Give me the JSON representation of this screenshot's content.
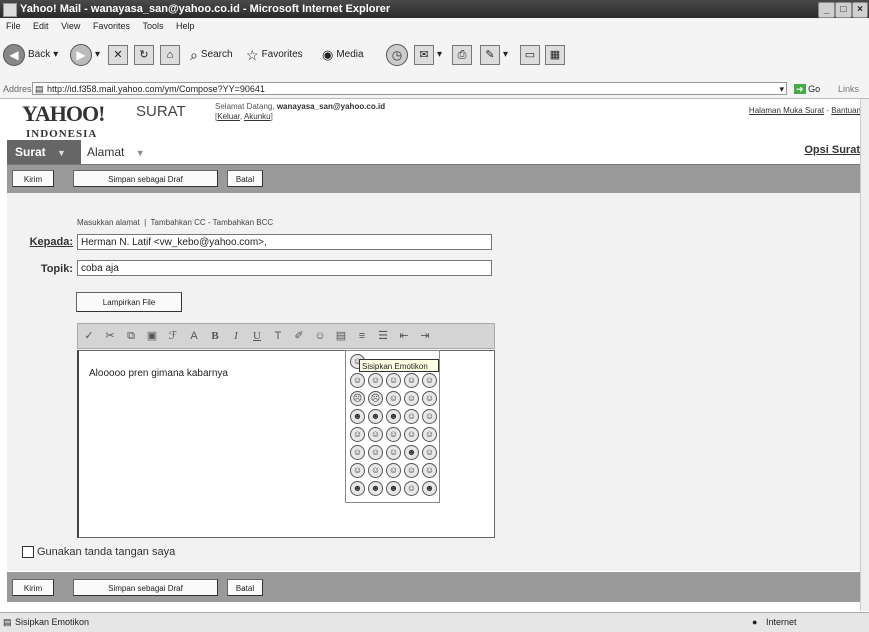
{
  "window": {
    "title": "Yahoo! Mail - wanayasa_san@yahoo.co.id - Microsoft Internet Explorer"
  },
  "menu": [
    "File",
    "Edit",
    "View",
    "Favorites",
    "Tools",
    "Help"
  ],
  "toolbar": {
    "back": "Back",
    "search": "Search",
    "favorites": "Favorites",
    "media": "Media"
  },
  "address": {
    "label": "Address",
    "url": "http://id.f358.mail.yahoo.com/ym/Compose?YY=90641",
    "go": "Go",
    "links": "Links"
  },
  "header": {
    "logo": "YAHOO!",
    "logo_sub": "INDONESIA",
    "brand": "SURAT",
    "welcome_prefix": "Selamat Datang, ",
    "welcome_user": "wanayasa_san@yahoo.co.id",
    "logout": "Keluar",
    "account": "Akunku",
    "mail_home": "Halaman Muka Surat",
    "help": "Bantuan"
  },
  "nav": {
    "tab_surat": "Surat",
    "tab_alamat": "Alamat",
    "options": "Opsi Surat"
  },
  "actions": {
    "send": "Kirim",
    "save_draft": "Simpan sebagai Draf",
    "cancel": "Batal"
  },
  "compose": {
    "helper_address": "Masukkan alamat",
    "helper_sep": "|",
    "helper_cc": "Tambahkan CC",
    "helper_dash": "-",
    "helper_bcc": "Tambahkan BCC",
    "to_label": "Kepada:",
    "to_value": "Herman N. Latif <vw_kebo@yahoo.com>,",
    "subject_label": "Topik:",
    "subject_value": "coba aja",
    "attach": "Lampirkan File",
    "body": "Alooooo pren gimana kabarnya",
    "signature": "Gunakan tanda tangan saya"
  },
  "emoticon_tooltip": "Sisipkan Emotikon",
  "status": {
    "text": "Sisipkan Emotikon",
    "zone": "Internet"
  },
  "colors": {
    "action_bar": "#9a9a9a",
    "tab_active": "#666666",
    "form_bg": "#f2f2f2"
  }
}
